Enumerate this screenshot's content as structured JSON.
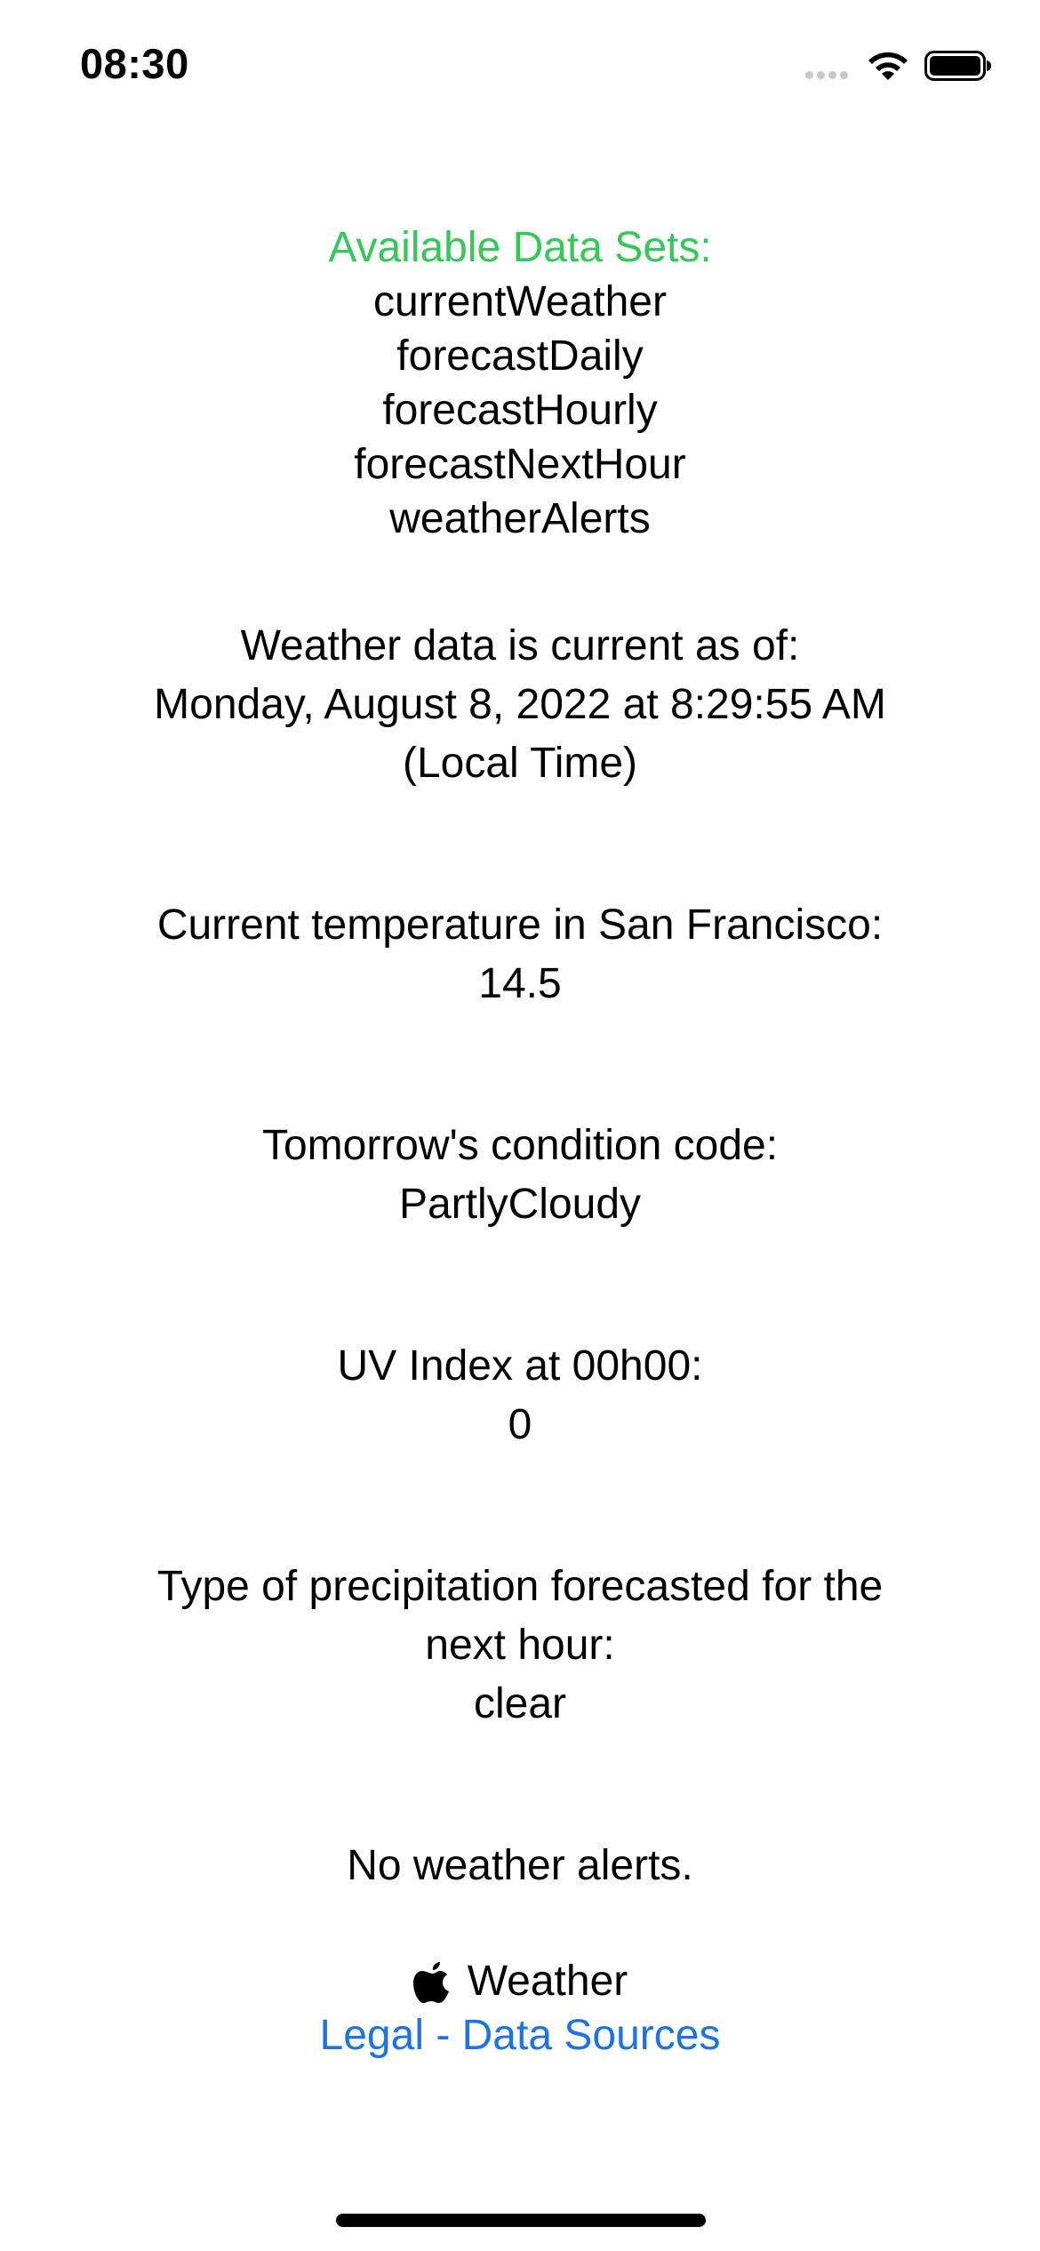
{
  "status_bar": {
    "time": "08:30",
    "icons": [
      "signal-icon",
      "wifi-icon",
      "battery-icon"
    ]
  },
  "data_sets": {
    "title": "Available Data Sets:",
    "items": [
      "currentWeather",
      "forecastDaily",
      "forecastHourly",
      "forecastNextHour",
      "weatherAlerts"
    ]
  },
  "as_of": {
    "label": "Weather data is current as of:",
    "value_line1": "Monday, August 8, 2022 at 8:29:55 AM",
    "value_line2": "(Local Time)"
  },
  "temperature": {
    "label": "Current temperature in San Francisco:",
    "value": "14.5"
  },
  "condition": {
    "label": "Tomorrow's condition code:",
    "value": "PartlyCloudy"
  },
  "uv": {
    "label": "UV Index at 00h00:",
    "value": "0"
  },
  "precipitation": {
    "label_line1": "Type of precipitation forecasted for the",
    "label_line2": "next hour:",
    "value": "clear"
  },
  "alerts": {
    "text": "No weather alerts."
  },
  "attribution": {
    "brand": "Weather",
    "legal_link": "Legal - Data Sources"
  },
  "colors": {
    "accent_green": "#34c759",
    "link_blue": "#1a73e8"
  }
}
